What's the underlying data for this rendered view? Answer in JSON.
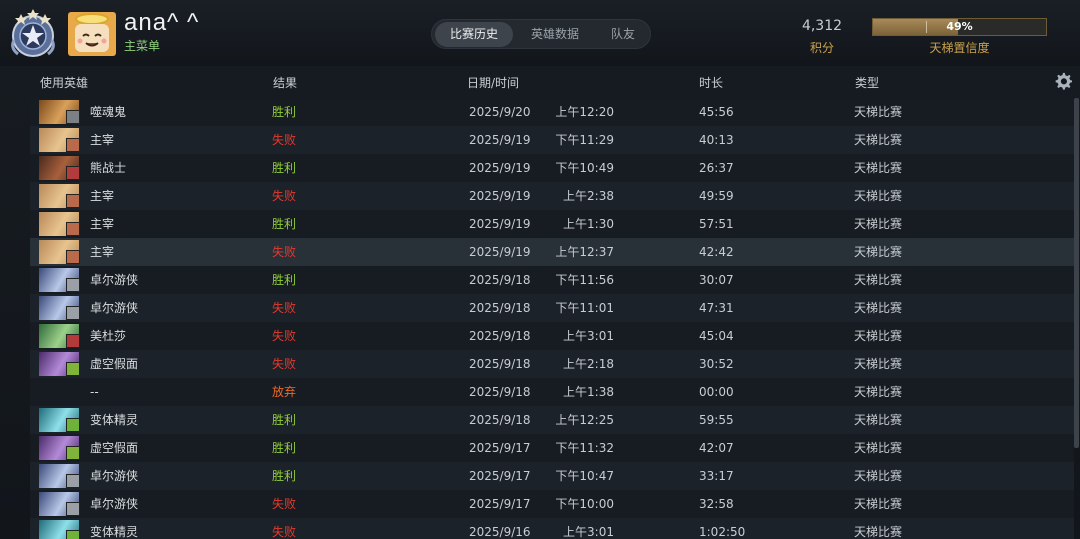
{
  "player": {
    "name": "ana^ ^",
    "subtitle": "主菜单"
  },
  "tabs": [
    {
      "label": "比赛历史",
      "active": true
    },
    {
      "label": "英雄数据",
      "active": false
    },
    {
      "label": "队友",
      "active": false
    }
  ],
  "stats": {
    "score_value": "4,312",
    "score_label": "积分",
    "confidence_percent": 49,
    "confidence_text": "49%",
    "confidence_label": "天梯置信度"
  },
  "columns": {
    "hero": "使用英雄",
    "result": "结果",
    "datetime": "日期/时间",
    "duration": "时长",
    "type": "类型"
  },
  "colors": {
    "win": "#8fcc3a",
    "loss": "#e23a2e",
    "abandon": "#ea6a2a",
    "accent_gold": "#caa24a"
  },
  "matches": [
    {
      "hero": "噬魂鬼",
      "result": "胜利",
      "outcome": "win",
      "date": "2025/9/20",
      "time": "上午12:20",
      "duration": "45:56",
      "type": "天梯比赛",
      "portrait": "lifestealer",
      "badge": "shield"
    },
    {
      "hero": "主宰",
      "result": "失败",
      "outcome": "loss",
      "date": "2025/9/19",
      "time": "下午11:29",
      "duration": "40:13",
      "type": "天梯比赛",
      "portrait": "juggernaut",
      "badge": "timer"
    },
    {
      "hero": "熊战士",
      "result": "胜利",
      "outcome": "win",
      "date": "2025/9/19",
      "time": "下午10:49",
      "duration": "26:37",
      "type": "天梯比赛",
      "portrait": "ursa",
      "badge": "sword"
    },
    {
      "hero": "主宰",
      "result": "失败",
      "outcome": "loss",
      "date": "2025/9/19",
      "time": "上午2:38",
      "duration": "49:59",
      "type": "天梯比赛",
      "portrait": "juggernaut",
      "badge": "timer"
    },
    {
      "hero": "主宰",
      "result": "胜利",
      "outcome": "win",
      "date": "2025/9/19",
      "time": "上午1:30",
      "duration": "57:51",
      "type": "天梯比赛",
      "portrait": "juggernaut",
      "badge": "timer"
    },
    {
      "hero": "主宰",
      "result": "失败",
      "outcome": "loss",
      "date": "2025/9/19",
      "time": "上午12:37",
      "duration": "42:42",
      "type": "天梯比赛",
      "portrait": "juggernaut",
      "badge": "timer",
      "highlight": true
    },
    {
      "hero": "卓尔游侠",
      "result": "胜利",
      "outcome": "win",
      "date": "2025/9/18",
      "time": "下午11:56",
      "duration": "30:07",
      "type": "天梯比赛",
      "portrait": "drow",
      "badge": "wand"
    },
    {
      "hero": "卓尔游侠",
      "result": "失败",
      "outcome": "loss",
      "date": "2025/9/18",
      "time": "下午11:01",
      "duration": "47:31",
      "type": "天梯比赛",
      "portrait": "drow",
      "badge": "wand"
    },
    {
      "hero": "美杜莎",
      "result": "失败",
      "outcome": "loss",
      "date": "2025/9/18",
      "time": "上午3:01",
      "duration": "45:04",
      "type": "天梯比赛",
      "portrait": "medusa",
      "badge": "arrow"
    },
    {
      "hero": "虚空假面",
      "result": "失败",
      "outcome": "loss",
      "date": "2025/9/18",
      "time": "上午2:18",
      "duration": "30:52",
      "type": "天梯比赛",
      "portrait": "voidface",
      "badge": "ring"
    },
    {
      "hero": "--",
      "result": "放弃",
      "outcome": "abandon",
      "date": "2025/9/18",
      "time": "上午1:38",
      "duration": "00:00",
      "type": "天梯比赛",
      "portrait": "",
      "badge": ""
    },
    {
      "hero": "变体精灵",
      "result": "胜利",
      "outcome": "win",
      "date": "2025/9/18",
      "time": "上午12:25",
      "duration": "59:55",
      "type": "天梯比赛",
      "portrait": "morphling",
      "badge": "leaf"
    },
    {
      "hero": "虚空假面",
      "result": "胜利",
      "outcome": "win",
      "date": "2025/9/17",
      "time": "下午11:32",
      "duration": "42:07",
      "type": "天梯比赛",
      "portrait": "voidface",
      "badge": "ring"
    },
    {
      "hero": "卓尔游侠",
      "result": "胜利",
      "outcome": "win",
      "date": "2025/9/17",
      "time": "下午10:47",
      "duration": "33:17",
      "type": "天梯比赛",
      "portrait": "drow",
      "badge": "wand"
    },
    {
      "hero": "卓尔游侠",
      "result": "失败",
      "outcome": "loss",
      "date": "2025/9/17",
      "time": "下午10:00",
      "duration": "32:58",
      "type": "天梯比赛",
      "portrait": "drow",
      "badge": "wand"
    },
    {
      "hero": "变体精灵",
      "result": "失败",
      "outcome": "loss",
      "date": "2025/9/16",
      "time": "上午3:01",
      "duration": "1:02:50",
      "type": "天梯比赛",
      "portrait": "morphling",
      "badge": "leaf"
    }
  ]
}
